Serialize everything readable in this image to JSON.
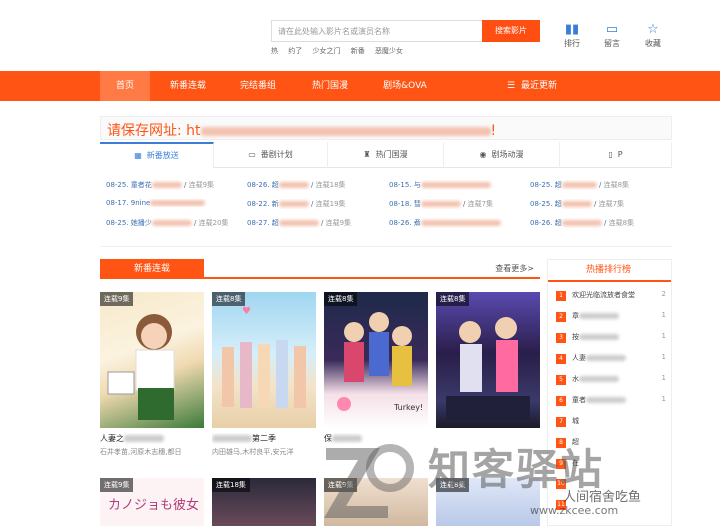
{
  "header": {
    "search_placeholder": "请在此处输入影片名或演员名称",
    "search_button": "搜索影片",
    "hot_words": [
      "热",
      "约了",
      "少女之门",
      "新番",
      "恶魔少女"
    ],
    "icons": [
      {
        "label": "排行",
        "icon": "bar-chart-icon"
      },
      {
        "label": "留言",
        "icon": "message-icon"
      },
      {
        "label": "收藏",
        "icon": "star-icon"
      }
    ]
  },
  "nav": {
    "items": [
      "首页",
      "新番连载",
      "完结番组",
      "热门国漫",
      "剧场&OVA",
      "最近更新"
    ]
  },
  "notice": {
    "prefix": "请保存网址: ht",
    "suffix": "!"
  },
  "tabs": [
    "新番放送",
    "番剧计划",
    "热门国漫",
    "剧场动漫",
    "P"
  ],
  "updates": [
    [
      "08-25. 童者花",
      "08-26. 超",
      "08-15. 与",
      "08-25. 超"
    ],
    [
      "08-17. 9nine",
      "08-22. 新",
      "08-18. 彗",
      "08-25. 超"
    ],
    [
      "08-25. 她播少",
      "08-27. 超",
      "08-26. 煮",
      "08-26. 超"
    ]
  ],
  "update_counts": [
    [
      "连载9集",
      "连载18集",
      "",
      "连载8集"
    ],
    [
      "",
      "连载19集",
      "连载7集",
      "连载7集"
    ],
    [
      "连载20集",
      "连载9集",
      "",
      "连载8集"
    ]
  ],
  "section": {
    "title": "新番连载",
    "more": "查看更多>"
  },
  "cards": [
    {
      "badge": "连载9集",
      "title": "人妻之",
      "sub": "石井孝苗,河原木志穗,都日",
      "colors": [
        "#f7e8c8",
        "#3c7a3a"
      ]
    },
    {
      "badge": "连载8集",
      "title": "第二季",
      "sub": "内田雄马,木村良平,安元洋",
      "colors": [
        "#bfe3f5",
        "#f2c6a8"
      ]
    },
    {
      "badge": "连载8集",
      "title": "保",
      "sub": "",
      "colors": [
        "#1e2a4a",
        "#d9486c"
      ]
    },
    {
      "badge": "连载8集",
      "title": "",
      "sub": "",
      "colors": [
        "#2a1e4a",
        "#7a5ad0"
      ]
    }
  ],
  "cards_row2": [
    {
      "badge": "连载9集",
      "poster_text": "カノジョも彼女 Season"
    },
    {
      "badge": "连载18集",
      "poster_text": ""
    },
    {
      "badge": "连载9集",
      "poster_text": ""
    },
    {
      "badge": "连载8集",
      "poster_text": ""
    }
  ],
  "ranking": {
    "title": "热播排行榜",
    "items": [
      {
        "num": "1",
        "name": "欢迎光临流放者食堂",
        "count": "2"
      },
      {
        "num": "2",
        "name": "章",
        "count": "1"
      },
      {
        "num": "3",
        "name": "按",
        "count": "1"
      },
      {
        "num": "4",
        "name": "人妻",
        "count": "1"
      },
      {
        "num": "5",
        "name": "水",
        "count": "1"
      },
      {
        "num": "6",
        "name": "童者",
        "count": "1"
      },
      {
        "num": "7",
        "name": "城",
        "count": ""
      },
      {
        "num": "8",
        "name": "超",
        "count": ""
      },
      {
        "num": "9",
        "name": "在",
        "count": ""
      },
      {
        "num": "10",
        "name": "",
        "count": ""
      },
      {
        "num": "11",
        "name": "",
        "count": ""
      }
    ]
  },
  "watermark": {
    "big": "知客驿站",
    "small": "人间宿舍吃鱼",
    "url": "www.zkcee.com"
  },
  "colors": {
    "brand": "#ff5414",
    "link": "#3b6fb0",
    "tab_active": "#3b7dd8"
  }
}
